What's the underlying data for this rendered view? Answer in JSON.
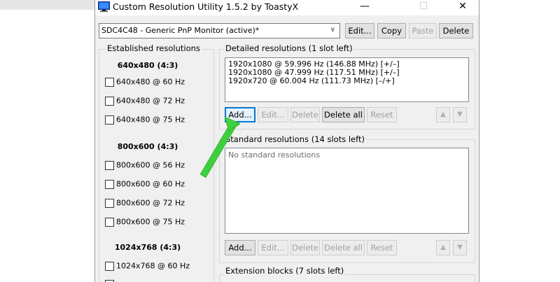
{
  "window": {
    "title": "Custom Resolution Utility 1.5.2 by ToastyX",
    "controls": {
      "minimize": "—",
      "maximize": "☐",
      "close": "✕"
    }
  },
  "monitor": {
    "selected": "SDC4C48 - Generic PnP Monitor (active)*",
    "buttons": {
      "edit": "Edit...",
      "copy": "Copy",
      "paste": "Paste",
      "delete": "Delete"
    }
  },
  "established": {
    "label": "Established resolutions",
    "groups": [
      {
        "header": "640x480 (4:3)",
        "items": [
          "640x480 @ 60 Hz",
          "640x480 @ 72 Hz",
          "640x480 @ 75 Hz"
        ]
      },
      {
        "header": "800x600 (4:3)",
        "items": [
          "800x600 @ 56 Hz",
          "800x600 @ 60 Hz",
          "800x600 @ 72 Hz",
          "800x600 @ 75 Hz"
        ]
      },
      {
        "header": "1024x768 (4:3)",
        "items": [
          "1024x768 @ 60 Hz"
        ]
      }
    ]
  },
  "detailed": {
    "label": "Detailed resolutions (1 slot left)",
    "items": [
      "1920x1080 @ 59.996 Hz (146.88 MHz) [+/–]",
      "1920x1080 @ 47.999 Hz (117.51 MHz) [+/–]",
      "1920x720 @ 60.004 Hz (111.73 MHz) [–/+]"
    ],
    "buttons": {
      "add": "Add...",
      "edit": "Edit...",
      "delete": "Delete",
      "delete_all": "Delete all",
      "reset": "Reset"
    }
  },
  "standard": {
    "label": "Standard resolutions (14 slots left)",
    "placeholder": "No standard resolutions",
    "buttons": {
      "add": "Add...",
      "edit": "Edit...",
      "delete": "Delete",
      "delete_all": "Delete all",
      "reset": "Reset"
    }
  },
  "extension": {
    "label": "Extension blocks (7 slots left)"
  },
  "icons": {
    "up": "up-arrow-icon",
    "down": "down-arrow-icon",
    "app": "monitor-app-icon",
    "pointer": "green-arrow-pointer"
  },
  "colors": {
    "focus": "#0078d7",
    "pointer": "#3ecf3e",
    "window_bg": "#f0f0f0"
  }
}
